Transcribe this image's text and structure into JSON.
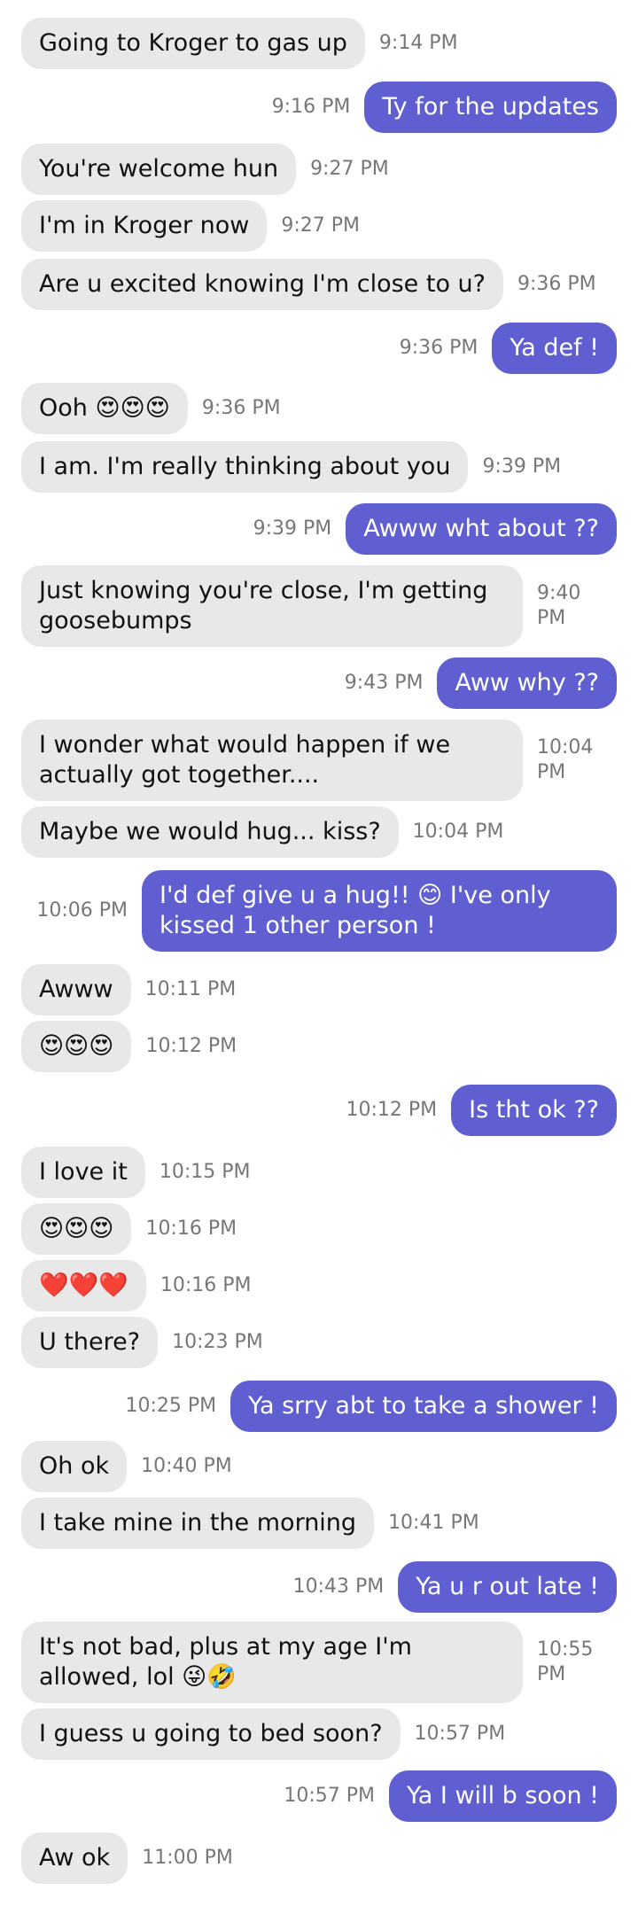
{
  "messages": [
    {
      "dir": "in",
      "text": "Going to Kroger to gas up",
      "time": "9:14 PM"
    },
    {
      "dir": "out",
      "text": "Ty for the updates",
      "time": "9:16 PM"
    },
    {
      "dir": "in",
      "text": "You're welcome hun",
      "time": "9:27 PM"
    },
    {
      "dir": "in",
      "text": "I'm in Kroger now",
      "time": "9:27 PM"
    },
    {
      "dir": "in",
      "text": "Are u excited knowing I'm close to u?",
      "time": "9:36 PM"
    },
    {
      "dir": "out",
      "text": "Ya def !",
      "time": "9:36 PM"
    },
    {
      "dir": "in",
      "text": "Ooh 😍😍😍",
      "time": "9:36 PM"
    },
    {
      "dir": "in",
      "text": "I am. I'm really thinking about you",
      "time": "9:39 PM"
    },
    {
      "dir": "out",
      "text": "Awww wht about ??",
      "time": "9:39 PM"
    },
    {
      "dir": "in",
      "text": "Just knowing you're close, I'm getting goosebumps",
      "time": "9:40 PM"
    },
    {
      "dir": "out",
      "text": "Aww why ??",
      "time": "9:43 PM"
    },
    {
      "dir": "in",
      "text": "I wonder what would happen if we actually got together....",
      "time": "10:04 PM"
    },
    {
      "dir": "in",
      "text": "Maybe we would hug... kiss?",
      "time": "10:04 PM"
    },
    {
      "dir": "out",
      "text": "I'd def give u a hug!! 😊 I've only kissed 1 other person !",
      "time": "10:06 PM"
    },
    {
      "dir": "in",
      "text": "Awww",
      "time": "10:11 PM"
    },
    {
      "dir": "in",
      "text": "😍😍😍",
      "time": "10:12 PM"
    },
    {
      "dir": "out",
      "text": "Is tht ok ??",
      "time": "10:12 PM"
    },
    {
      "dir": "in",
      "text": "I love it",
      "time": "10:15 PM"
    },
    {
      "dir": "in",
      "text": "😍😍😍",
      "time": "10:16 PM"
    },
    {
      "dir": "in",
      "text": "❤️❤️❤️",
      "time": "10:16 PM"
    },
    {
      "dir": "in",
      "text": "U there?",
      "time": "10:23 PM"
    },
    {
      "dir": "out",
      "text": "Ya srry abt to take a shower !",
      "time": "10:25 PM"
    },
    {
      "dir": "in",
      "text": "Oh ok",
      "time": "10:40 PM"
    },
    {
      "dir": "in",
      "text": "I take mine in the morning",
      "time": "10:41 PM"
    },
    {
      "dir": "out",
      "text": "Ya u r out late !",
      "time": "10:43 PM"
    },
    {
      "dir": "in",
      "text": "It's not bad, plus at my age I'm allowed, lol 😜🤣",
      "time": "10:55 PM"
    },
    {
      "dir": "in",
      "text": "I guess u going to bed soon?",
      "time": "10:57 PM"
    },
    {
      "dir": "out",
      "text": "Ya I will b soon !",
      "time": "10:57 PM"
    },
    {
      "dir": "in",
      "text": "Aw ok",
      "time": "11:00 PM"
    }
  ]
}
